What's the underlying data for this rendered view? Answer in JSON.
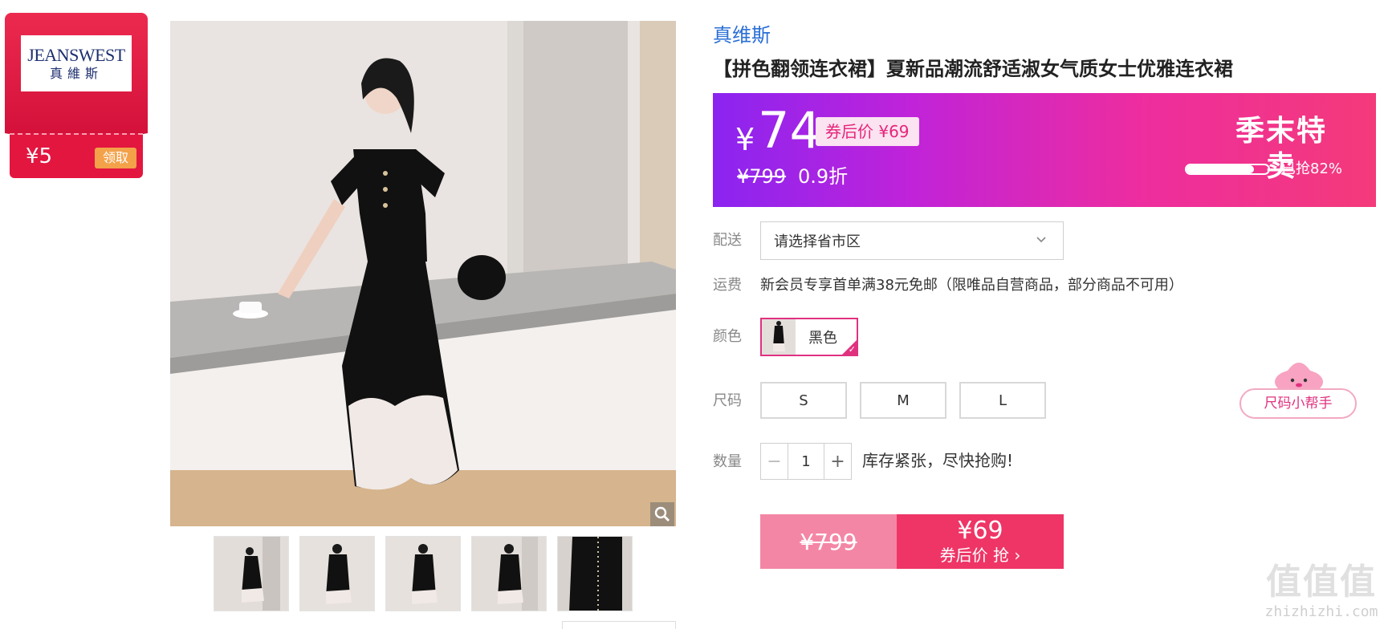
{
  "coupon": {
    "brand_logo_en": "JEANSWEST",
    "brand_logo_cn": "真維斯",
    "amount": "¥5",
    "claim_label": "领取"
  },
  "product": {
    "brand": "真维斯",
    "title": "【拼色翻领连衣裙】夏新品潮流舒适淑女气质女士优雅连衣裙",
    "thumbnails": [
      "dress-front",
      "dress-front-2",
      "dress-front-3",
      "dress-front-4",
      "dress-detail"
    ]
  },
  "price_banner": {
    "currency": "¥",
    "current_price": "74",
    "after_coupon": "券后价 ¥69",
    "original_price": "¥799",
    "discount": "0.9折",
    "sale_label": "季末特卖",
    "sold_percent": 82,
    "sold_text": "已抢82%",
    "colors": {
      "start": "#8b24f0",
      "end": "#f43a7a"
    }
  },
  "delivery": {
    "label": "配送",
    "value": "请选择省市区"
  },
  "shipping": {
    "label": "运费",
    "text": "新会员专享首单满38元免邮（限唯品自营商品，部分商品不可用）"
  },
  "color": {
    "label": "颜色",
    "option": "黑色"
  },
  "size": {
    "label": "尺码",
    "options": [
      "S",
      "M",
      "L"
    ],
    "helper": "尺码小帮手"
  },
  "quantity": {
    "label": "数量",
    "value": "1",
    "stock_text": "库存紧张，尽快抢购!"
  },
  "buy": {
    "original_price": "¥799",
    "price": "¥69",
    "action": "券后价 抢 ›"
  },
  "watermark": {
    "chars": "值值值",
    "domain": "zhizhizhi.com"
  }
}
